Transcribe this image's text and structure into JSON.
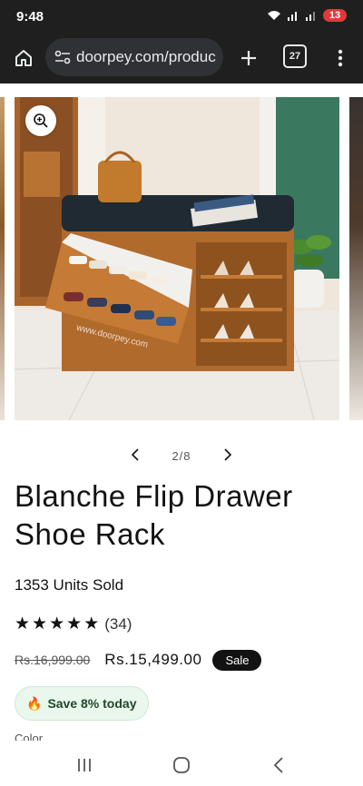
{
  "status": {
    "time": "9:48",
    "battery": "13"
  },
  "browser": {
    "url": "doorpey.com/produc",
    "tab_count": "27"
  },
  "gallery": {
    "current": "2/8",
    "watermark": "www.doorpey.com"
  },
  "product": {
    "title_line1": "Blanche Flip Drawer",
    "title_line2": "Shoe Rack",
    "units_sold": "1353 Units Sold",
    "rating": 5,
    "review_count": "(34)",
    "old_price": "Rs.16,999.00",
    "new_price": "Rs.15,499.00",
    "sale_label": "Sale",
    "save_text": "Save 8% today",
    "color_label": "Color"
  },
  "colors": {
    "sale_badge": "#121212",
    "save_chip_bg": "#e9f7ec",
    "cushion": "#1f2a33",
    "wood": "#b06a2c"
  }
}
